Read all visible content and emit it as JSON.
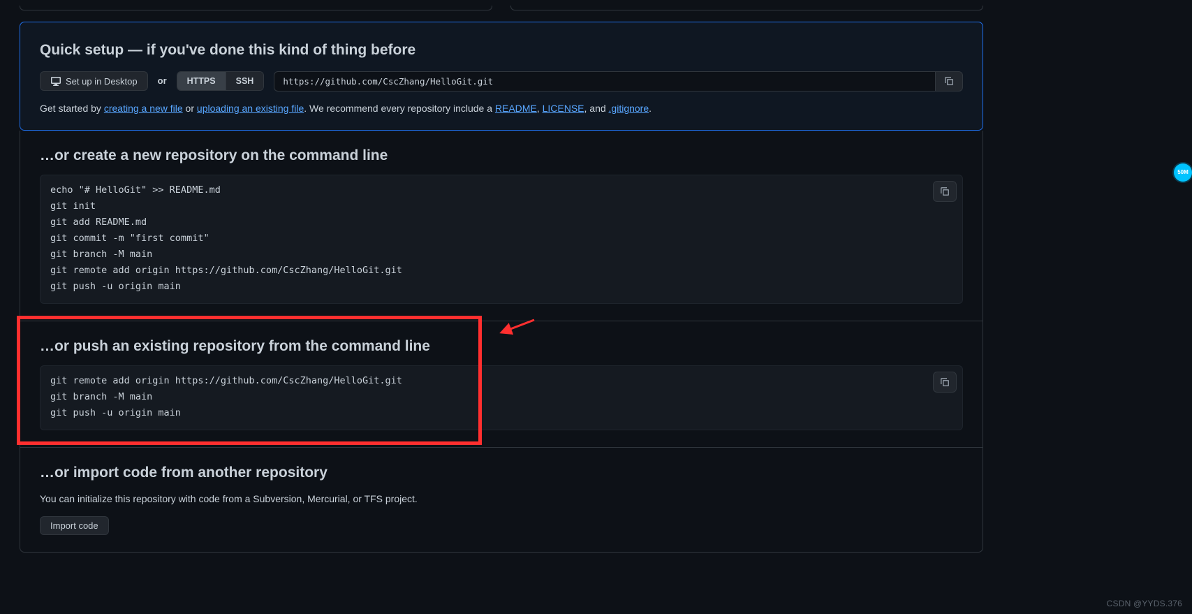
{
  "quick": {
    "title": "Quick setup — if you've done this kind of thing before",
    "desktop_label": "Set up in Desktop",
    "or_label": "or",
    "protocol_https": "HTTPS",
    "protocol_ssh": "SSH",
    "clone_url": "https://github.com/CscZhang/HelloGit.git",
    "hint_pre": "Get started by ",
    "link_newfile": "creating a new file",
    "hint_or": " or ",
    "link_upload": "uploading an existing file",
    "hint_mid": ". We recommend every repository include a ",
    "link_readme": "README",
    "comma": ", ",
    "link_license": "LICENSE",
    "hint_and": ", and ",
    "link_gitignore": ".gitignore",
    "hint_end": "."
  },
  "section_create": {
    "heading": "…or create a new repository on the command line",
    "code": "echo \"# HelloGit\" >> README.md\ngit init\ngit add README.md\ngit commit -m \"first commit\"\ngit branch -M main\ngit remote add origin https://github.com/CscZhang/HelloGit.git\ngit push -u origin main"
  },
  "section_push": {
    "heading": "…or push an existing repository from the command line",
    "code": "git remote add origin https://github.com/CscZhang/HelloGit.git\ngit branch -M main\ngit push -u origin main"
  },
  "section_import": {
    "heading": "…or import code from another repository",
    "desc": "You can initialize this repository with code from a Subversion, Mercurial, or TFS project.",
    "button": "Import code"
  },
  "watermark": "CSDN @YYDS.376",
  "badge": "50M"
}
